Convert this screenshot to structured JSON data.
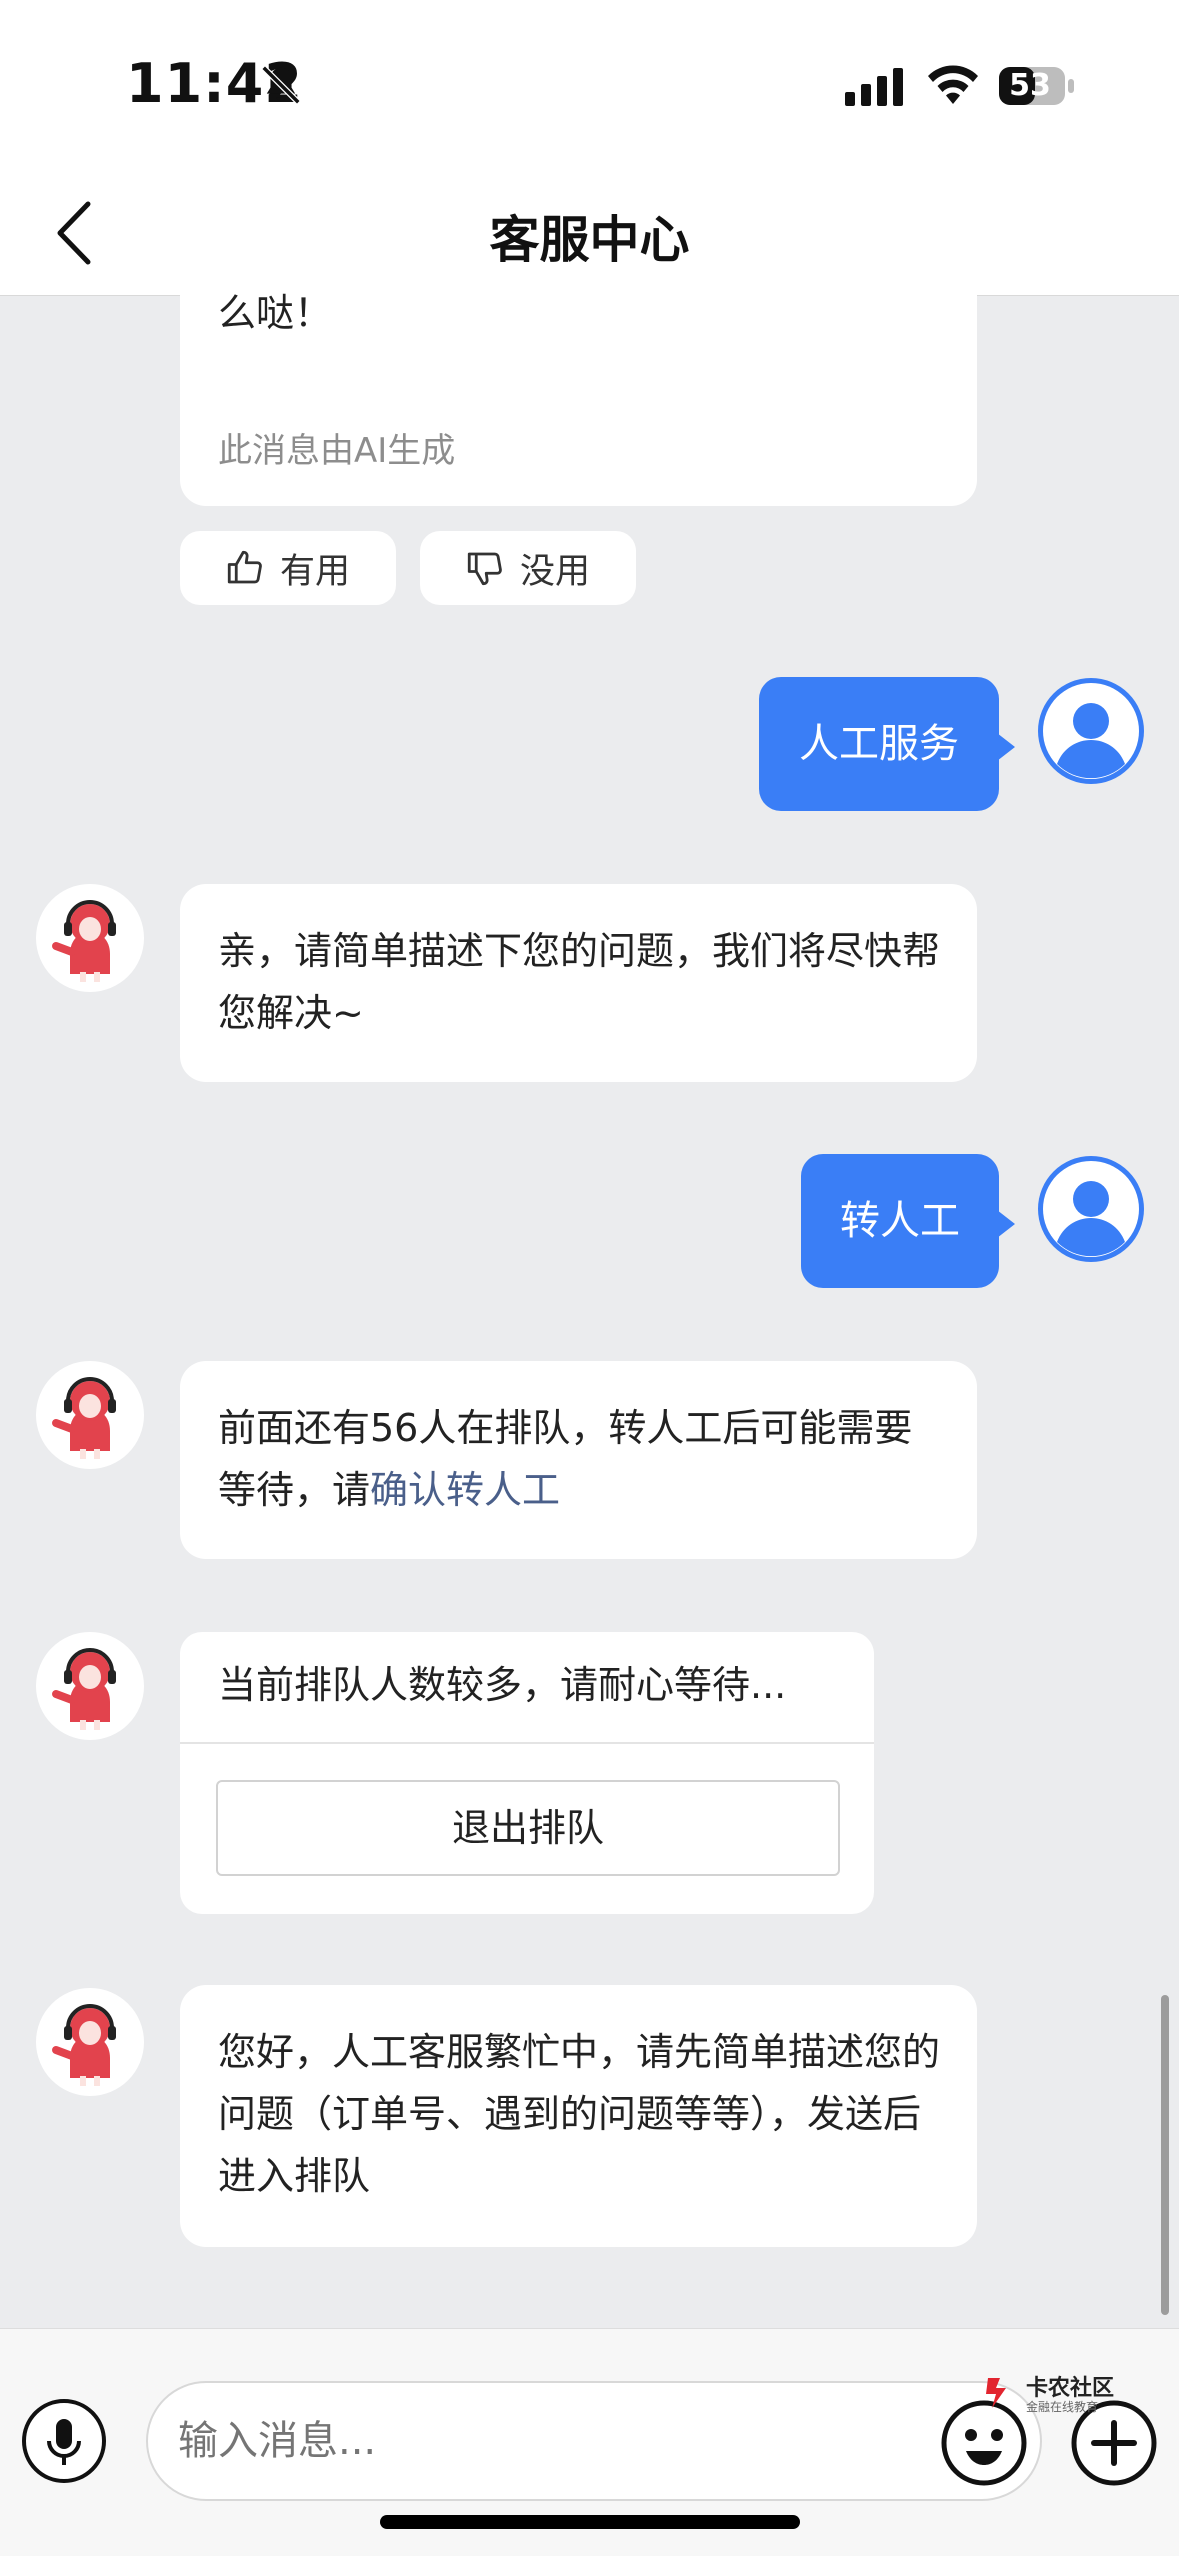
{
  "status_bar": {
    "time": "11:42",
    "battery": "53"
  },
  "header": {
    "title": "客服中心"
  },
  "messages": {
    "ai_reply_tail": "么哒！",
    "ai_note": "此消息由AI生成",
    "feedback_useful": "有用",
    "feedback_useless": "没用",
    "user_1": "人工服务",
    "bot_1": "亲，请简单描述下您的问题，我们将尽快帮您解决~",
    "user_2": "转人工",
    "bot_2_prefix": "前面还有56人在排队，转人工后可能需要等待，请",
    "bot_2_link": "确认转人工",
    "queue_status": "当前排队人数较多，请耐心等待...",
    "queue_exit": "退出排队",
    "bot_3": "您好，人工客服繁忙中，请先简单描述您的问题（订单号、遇到的问题等等），发送后进入排队"
  },
  "input": {
    "placeholder": "输入消息..."
  },
  "watermark": {
    "title": "卡农社区",
    "subtitle": "金融在线教育"
  },
  "colors": {
    "accent": "#3a7ef6",
    "background": "#ebecee",
    "link": "#4a5f8a"
  }
}
